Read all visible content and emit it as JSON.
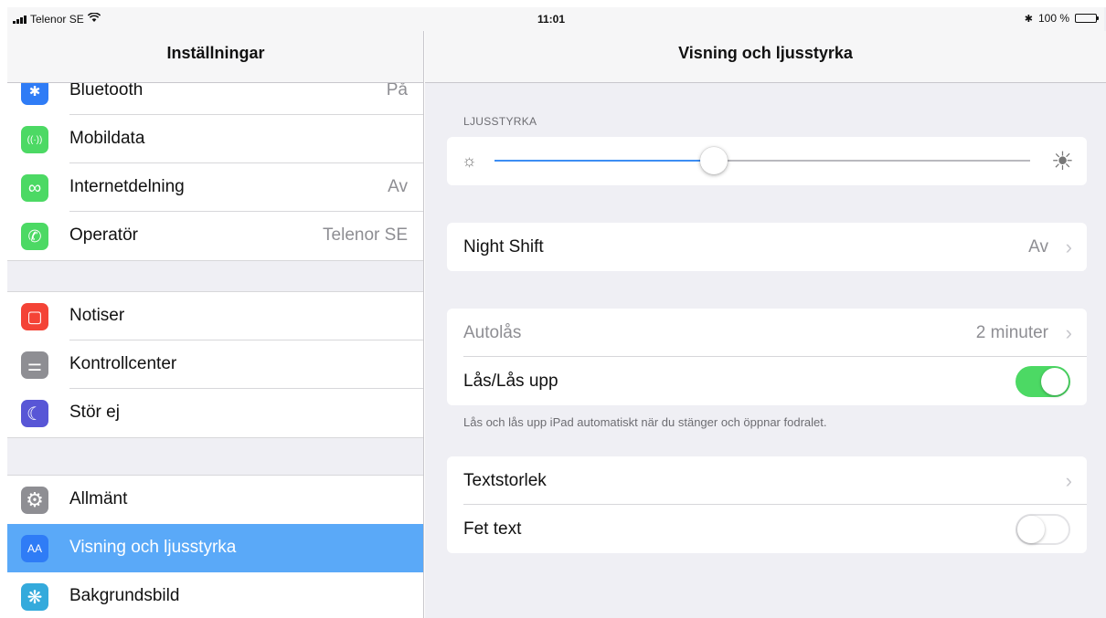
{
  "status_bar": {
    "carrier": "Telenor SE",
    "time": "11:01",
    "bluetooth_glyph": "✱",
    "battery": "100 %",
    "battery_level": 1.0
  },
  "sidebar": {
    "title": "Inställningar",
    "groups": [
      [
        {
          "label": "Bluetooth",
          "value": "På",
          "icon": "bluetooth-icon",
          "color": "#2f7cf6",
          "glyph": "✱"
        },
        {
          "label": "Mobildata",
          "value": "",
          "icon": "antenna-icon",
          "color": "#4cd964",
          "glyph": "((·))"
        },
        {
          "label": "Internetdelning",
          "value": "Av",
          "icon": "hotspot-icon",
          "color": "#4cd964",
          "glyph": "∞"
        },
        {
          "label": "Operatör",
          "value": "Telenor SE",
          "icon": "phone-icon",
          "color": "#4cd964",
          "glyph": "✆"
        }
      ],
      [
        {
          "label": "Notiser",
          "value": "",
          "icon": "notifications-icon",
          "color": "#f44336",
          "glyph": "▢"
        },
        {
          "label": "Kontrollcenter",
          "value": "",
          "icon": "control-center-icon",
          "color": "#8e8e93",
          "glyph": "⚌"
        },
        {
          "label": "Stör ej",
          "value": "",
          "icon": "moon-icon",
          "color": "#5856d6",
          "glyph": "☾"
        }
      ],
      [
        {
          "label": "Allmänt",
          "value": "",
          "icon": "gear-icon",
          "color": "#8e8e93",
          "glyph": "⚙"
        },
        {
          "label": "Visning och ljusstyrka",
          "value": "",
          "icon": "display-icon",
          "color": "#2f7cf6",
          "glyph": "AA",
          "selected": true
        },
        {
          "label": "Bakgrundsbild",
          "value": "",
          "icon": "wallpaper-icon",
          "color": "#34aadc",
          "glyph": "❋"
        }
      ]
    ]
  },
  "main": {
    "title": "Visning och ljusstyrka",
    "brightness": {
      "section_label": "LJUSSTYRKA",
      "level": 0.41
    },
    "night_shift": {
      "label": "Night Shift",
      "value": "Av"
    },
    "autolock": {
      "label": "Autolås",
      "value": "2 minuter"
    },
    "lock_unlock": {
      "label": "Lås/Lås upp",
      "on": true
    },
    "lock_footer": "Lås och lås upp iPad automatiskt när du stänger och öppnar fodralet.",
    "text_size": {
      "label": "Textstorlek"
    },
    "bold_text": {
      "label": "Fet text",
      "on": false
    }
  }
}
